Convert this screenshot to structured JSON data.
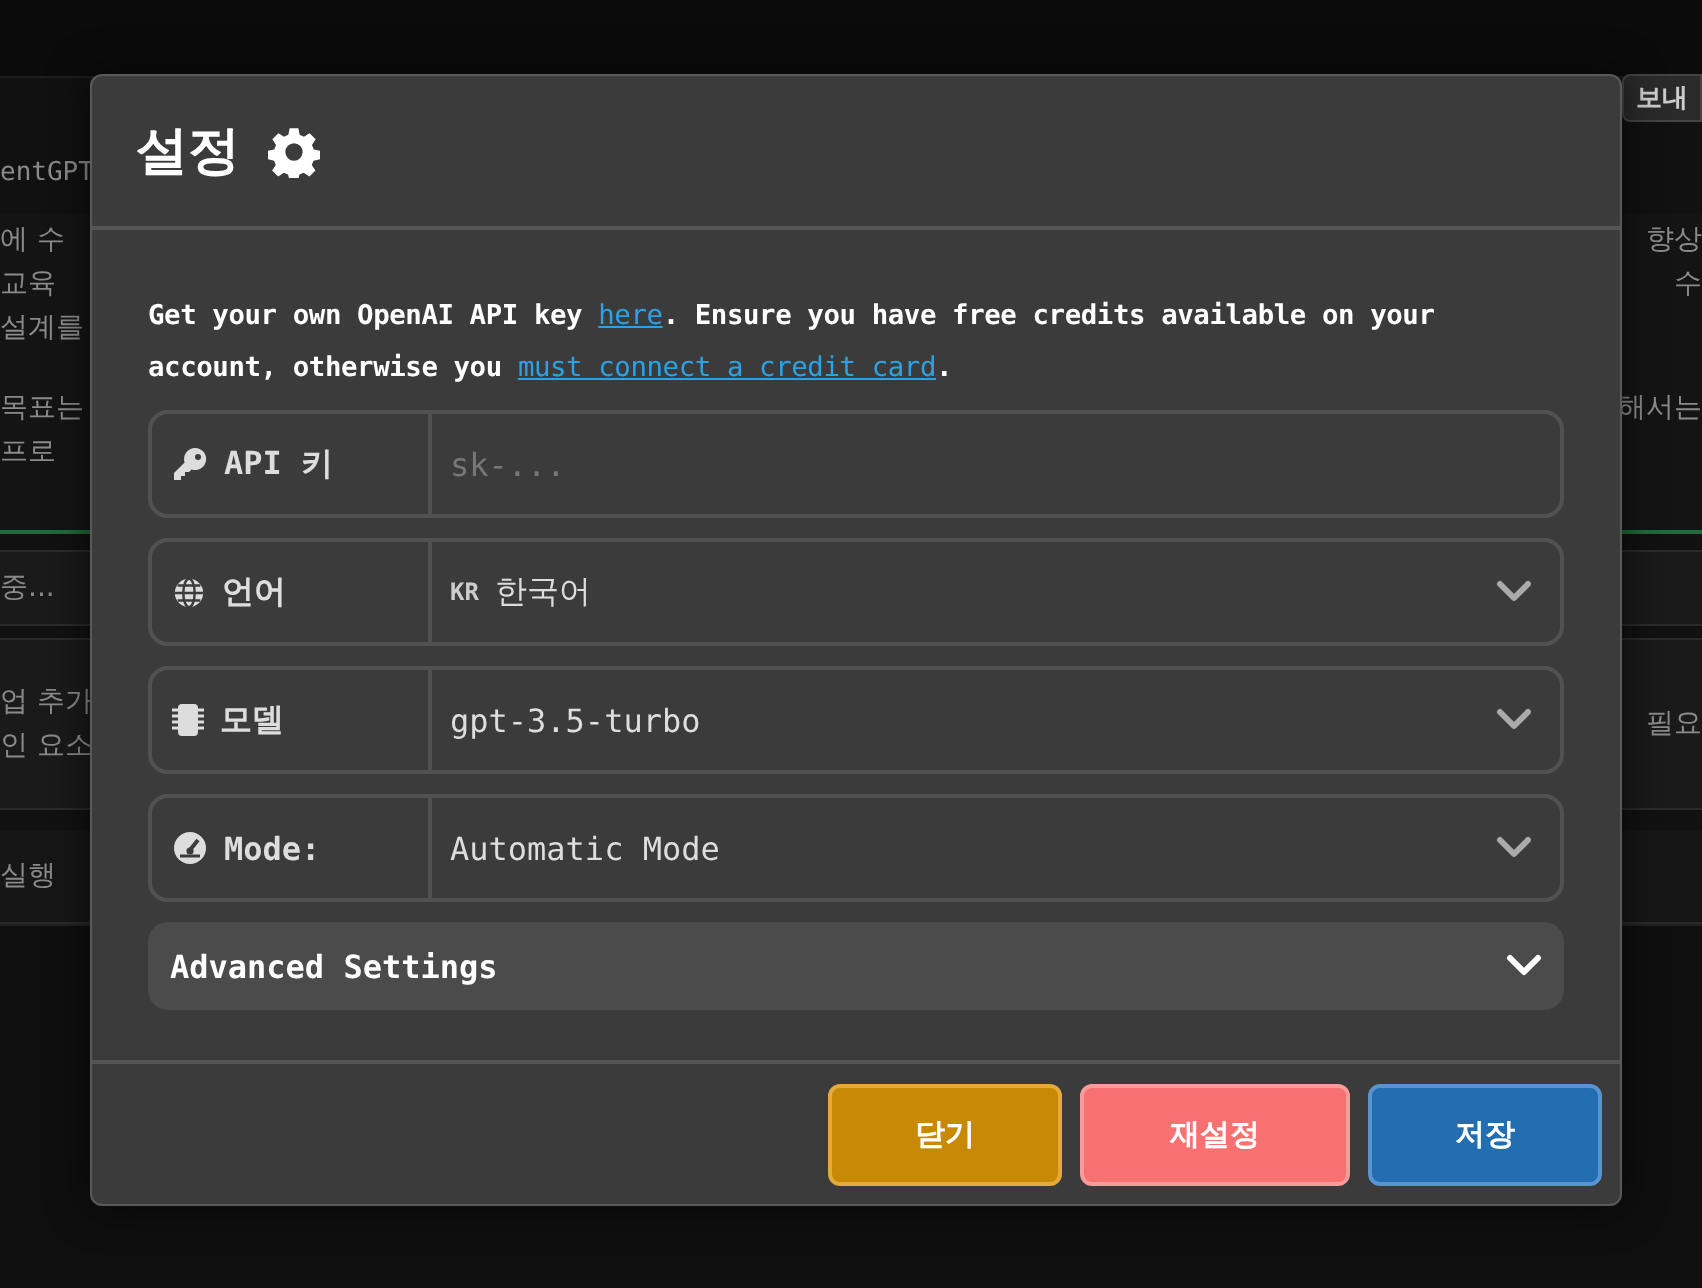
{
  "background": {
    "app_title": "entGPT",
    "export_button": "보내",
    "goal_box": {
      "paragraphs": [
        {
          "left": [
            "에 수",
            "교육",
            "설계를"
          ],
          "right": [
            "향상",
            "수"
          ]
        },
        {
          "left": [
            "목표는",
            "프로"
          ],
          "right": [
            "해서는"
          ]
        }
      ]
    },
    "status_row": "중...",
    "task_box": {
      "left": [
        "업 추가",
        "인 요소"
      ],
      "right": [
        "필요"
      ]
    },
    "run_row": "실행"
  },
  "dialog": {
    "title": "설정",
    "intro_parts": [
      {
        "kind": "text",
        "text": "Get your own OpenAI API key "
      },
      {
        "kind": "link",
        "text": "here"
      },
      {
        "kind": "text",
        "text": ". Ensure you have free credits available on your account, otherwise you "
      },
      {
        "kind": "link",
        "text": "must connect a credit card"
      },
      {
        "kind": "text",
        "text": "."
      }
    ],
    "fields": [
      {
        "kind": "input",
        "label": "API 키",
        "placeholder": "sk-..."
      },
      {
        "kind": "select",
        "label": "언어",
        "flag": "KR",
        "value": "한국어"
      },
      {
        "kind": "select",
        "label": "모델",
        "value": "gpt-3.5-turbo"
      },
      {
        "kind": "select",
        "label": "Mode:",
        "value": "Automatic Mode"
      }
    ],
    "advanced": {
      "label": "Advanced Settings",
      "expanded": false
    },
    "buttons": [
      {
        "kind": "close",
        "label": "닫기"
      },
      {
        "kind": "reset",
        "label": "재설정"
      },
      {
        "kind": "save",
        "label": "저장"
      }
    ]
  }
}
